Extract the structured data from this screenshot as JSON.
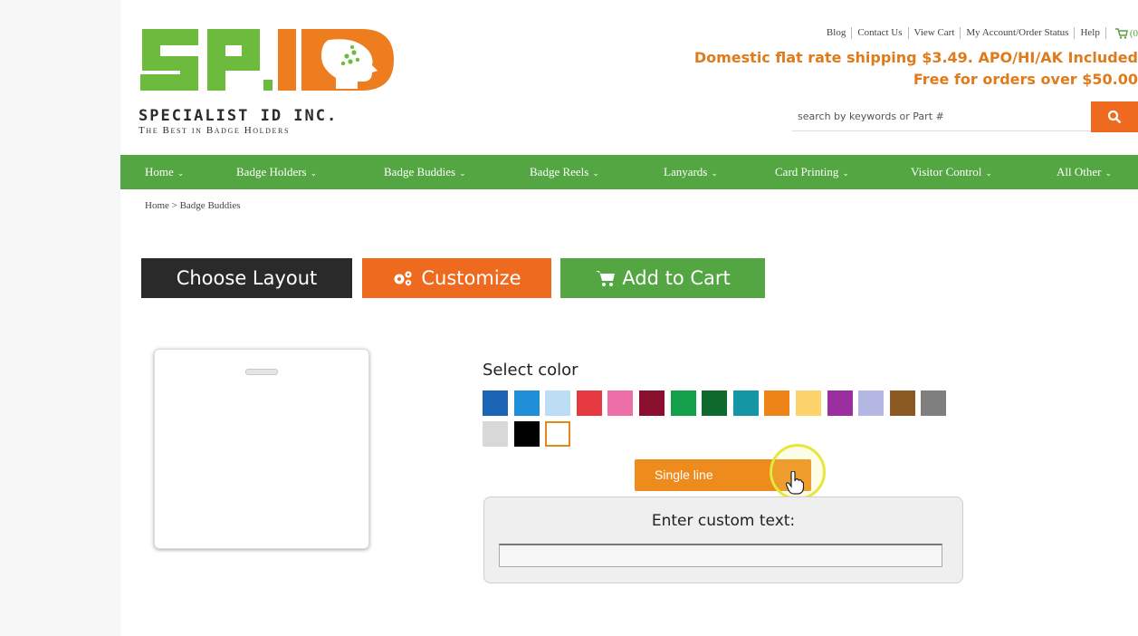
{
  "logo": {
    "mark_text": "SP.ID",
    "company": "SPECIALIST ID INC.",
    "tagline": "The Best in Badge Holders"
  },
  "top_links": [
    "Blog",
    "Contact Us",
    "View Cart",
    "My Account/Order Status",
    "Help"
  ],
  "cart_count": "(0",
  "shipping": {
    "line1": "Domestic flat rate shipping $3.49. APO/HI/AK Included",
    "line2": "Free for orders over $50.00"
  },
  "search": {
    "placeholder": "search by keywords or Part #"
  },
  "nav": [
    {
      "label": "Home"
    },
    {
      "label": "Badge Holders"
    },
    {
      "label": "Badge Buddies"
    },
    {
      "label": "Badge Reels"
    },
    {
      "label": "Lanyards"
    },
    {
      "label": "Card Printing"
    },
    {
      "label": "Visitor Control"
    },
    {
      "label": "All Other"
    }
  ],
  "breadcrumb": "Home > Badge Buddies",
  "actions": {
    "choose_layout": "Choose Layout",
    "customize": "Customize",
    "add_to_cart": "Add to Cart"
  },
  "color_picker": {
    "label": "Select color",
    "swatches": [
      "#1a63b5",
      "#1f8fd8",
      "#bcdcf3",
      "#e53a3f",
      "#ec6fa8",
      "#8b1030",
      "#14a04a",
      "#0e6a2c",
      "#1596a5",
      "#ee8418",
      "#fbd36a",
      "#9a2fa0",
      "#b5b7e3",
      "#8a5a22",
      "#7f7f7f",
      "#d8d8d8",
      "#000000",
      "#ffffff"
    ],
    "selected_index": 17
  },
  "line_select": {
    "value": "Single line"
  },
  "custom_text": {
    "label": "Enter custom text:",
    "value": ""
  },
  "colors": {
    "brand_green": "#53a641",
    "brand_orange": "#ee6a1f",
    "shipping_orange": "#e07b1c",
    "dark_button": "#2a2a2a"
  }
}
